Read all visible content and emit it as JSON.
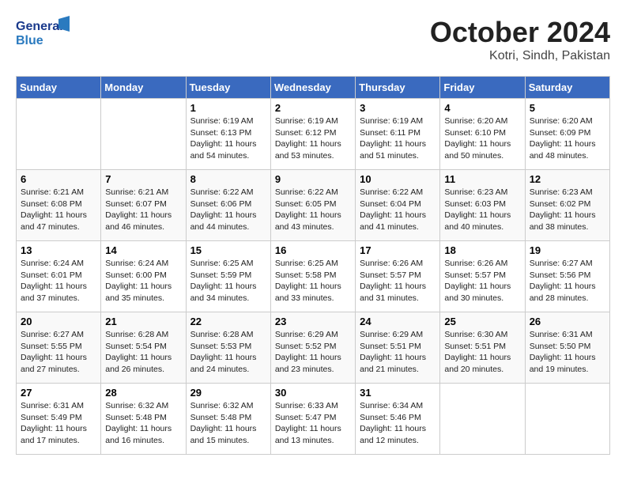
{
  "header": {
    "logo_line1": "General",
    "logo_line2": "Blue",
    "title": "October 2024",
    "subtitle": "Kotri, Sindh, Pakistan"
  },
  "days_of_week": [
    "Sunday",
    "Monday",
    "Tuesday",
    "Wednesday",
    "Thursday",
    "Friday",
    "Saturday"
  ],
  "weeks": [
    [
      {
        "day": "",
        "info": ""
      },
      {
        "day": "",
        "info": ""
      },
      {
        "day": "1",
        "info": "Sunrise: 6:19 AM\nSunset: 6:13 PM\nDaylight: 11 hours and 54 minutes."
      },
      {
        "day": "2",
        "info": "Sunrise: 6:19 AM\nSunset: 6:12 PM\nDaylight: 11 hours and 53 minutes."
      },
      {
        "day": "3",
        "info": "Sunrise: 6:19 AM\nSunset: 6:11 PM\nDaylight: 11 hours and 51 minutes."
      },
      {
        "day": "4",
        "info": "Sunrise: 6:20 AM\nSunset: 6:10 PM\nDaylight: 11 hours and 50 minutes."
      },
      {
        "day": "5",
        "info": "Sunrise: 6:20 AM\nSunset: 6:09 PM\nDaylight: 11 hours and 48 minutes."
      }
    ],
    [
      {
        "day": "6",
        "info": "Sunrise: 6:21 AM\nSunset: 6:08 PM\nDaylight: 11 hours and 47 minutes."
      },
      {
        "day": "7",
        "info": "Sunrise: 6:21 AM\nSunset: 6:07 PM\nDaylight: 11 hours and 46 minutes."
      },
      {
        "day": "8",
        "info": "Sunrise: 6:22 AM\nSunset: 6:06 PM\nDaylight: 11 hours and 44 minutes."
      },
      {
        "day": "9",
        "info": "Sunrise: 6:22 AM\nSunset: 6:05 PM\nDaylight: 11 hours and 43 minutes."
      },
      {
        "day": "10",
        "info": "Sunrise: 6:22 AM\nSunset: 6:04 PM\nDaylight: 11 hours and 41 minutes."
      },
      {
        "day": "11",
        "info": "Sunrise: 6:23 AM\nSunset: 6:03 PM\nDaylight: 11 hours and 40 minutes."
      },
      {
        "day": "12",
        "info": "Sunrise: 6:23 AM\nSunset: 6:02 PM\nDaylight: 11 hours and 38 minutes."
      }
    ],
    [
      {
        "day": "13",
        "info": "Sunrise: 6:24 AM\nSunset: 6:01 PM\nDaylight: 11 hours and 37 minutes."
      },
      {
        "day": "14",
        "info": "Sunrise: 6:24 AM\nSunset: 6:00 PM\nDaylight: 11 hours and 35 minutes."
      },
      {
        "day": "15",
        "info": "Sunrise: 6:25 AM\nSunset: 5:59 PM\nDaylight: 11 hours and 34 minutes."
      },
      {
        "day": "16",
        "info": "Sunrise: 6:25 AM\nSunset: 5:58 PM\nDaylight: 11 hours and 33 minutes."
      },
      {
        "day": "17",
        "info": "Sunrise: 6:26 AM\nSunset: 5:57 PM\nDaylight: 11 hours and 31 minutes."
      },
      {
        "day": "18",
        "info": "Sunrise: 6:26 AM\nSunset: 5:57 PM\nDaylight: 11 hours and 30 minutes."
      },
      {
        "day": "19",
        "info": "Sunrise: 6:27 AM\nSunset: 5:56 PM\nDaylight: 11 hours and 28 minutes."
      }
    ],
    [
      {
        "day": "20",
        "info": "Sunrise: 6:27 AM\nSunset: 5:55 PM\nDaylight: 11 hours and 27 minutes."
      },
      {
        "day": "21",
        "info": "Sunrise: 6:28 AM\nSunset: 5:54 PM\nDaylight: 11 hours and 26 minutes."
      },
      {
        "day": "22",
        "info": "Sunrise: 6:28 AM\nSunset: 5:53 PM\nDaylight: 11 hours and 24 minutes."
      },
      {
        "day": "23",
        "info": "Sunrise: 6:29 AM\nSunset: 5:52 PM\nDaylight: 11 hours and 23 minutes."
      },
      {
        "day": "24",
        "info": "Sunrise: 6:29 AM\nSunset: 5:51 PM\nDaylight: 11 hours and 21 minutes."
      },
      {
        "day": "25",
        "info": "Sunrise: 6:30 AM\nSunset: 5:51 PM\nDaylight: 11 hours and 20 minutes."
      },
      {
        "day": "26",
        "info": "Sunrise: 6:31 AM\nSunset: 5:50 PM\nDaylight: 11 hours and 19 minutes."
      }
    ],
    [
      {
        "day": "27",
        "info": "Sunrise: 6:31 AM\nSunset: 5:49 PM\nDaylight: 11 hours and 17 minutes."
      },
      {
        "day": "28",
        "info": "Sunrise: 6:32 AM\nSunset: 5:48 PM\nDaylight: 11 hours and 16 minutes."
      },
      {
        "day": "29",
        "info": "Sunrise: 6:32 AM\nSunset: 5:48 PM\nDaylight: 11 hours and 15 minutes."
      },
      {
        "day": "30",
        "info": "Sunrise: 6:33 AM\nSunset: 5:47 PM\nDaylight: 11 hours and 13 minutes."
      },
      {
        "day": "31",
        "info": "Sunrise: 6:34 AM\nSunset: 5:46 PM\nDaylight: 11 hours and 12 minutes."
      },
      {
        "day": "",
        "info": ""
      },
      {
        "day": "",
        "info": ""
      }
    ]
  ]
}
